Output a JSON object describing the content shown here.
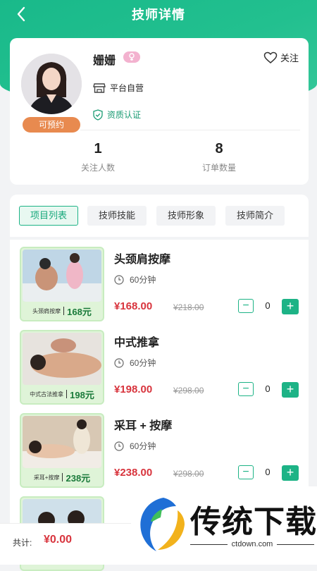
{
  "header": {
    "title": "技师详情"
  },
  "profile": {
    "name": "姗姗",
    "availability": "可预约",
    "follow_label": "关注",
    "store": "平台自营",
    "cert": "资质认证",
    "stats": [
      {
        "value": "1",
        "label": "关注人数"
      },
      {
        "value": "8",
        "label": "订单数量"
      }
    ]
  },
  "tabs": [
    "项目列表",
    "技师技能",
    "技师形象",
    "技师简介"
  ],
  "items": [
    {
      "name": "头颈肩按摩",
      "duration": "60分钟",
      "price": "¥168.00",
      "original": "¥218.00",
      "qty": "0",
      "thumb_caption": "头颈肩按摩",
      "thumb_price": "168元"
    },
    {
      "name": "中式推拿",
      "duration": "60分钟",
      "price": "¥198.00",
      "original": "¥298.00",
      "qty": "0",
      "thumb_caption": "中式古法推拿",
      "thumb_price": "198元"
    },
    {
      "name": "采耳 + 按摩",
      "duration": "60分钟",
      "price": "¥238.00",
      "original": "¥298.00",
      "qty": "0",
      "thumb_caption": "采耳+按摩",
      "thumb_price": "238元"
    }
  ],
  "footer": {
    "total_label": "共计:",
    "total_value": "¥0.00"
  },
  "watermark": {
    "brand": "传统下载",
    "url": "ctdown.com"
  },
  "colors": {
    "accent": "#1db386",
    "price": "#d8343d",
    "availability": "#e88a4f"
  }
}
